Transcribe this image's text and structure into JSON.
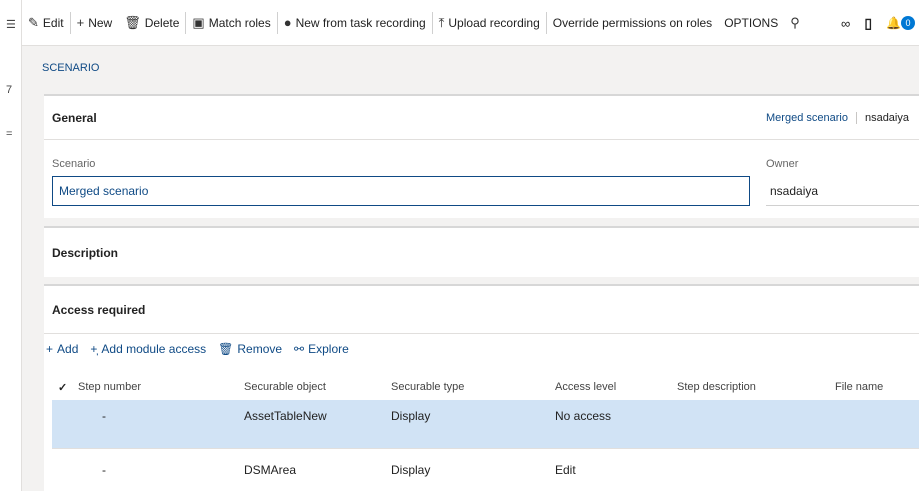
{
  "left_strip": {
    "glyphs": [
      "☰",
      "7",
      "="
    ]
  },
  "toolbar": {
    "edit": "Edit",
    "new": "New",
    "delete": "Delete",
    "match_roles": "Match roles",
    "new_from_task_recording": "New from task recording",
    "upload_recording": "Upload recording",
    "override_permissions": "Override permissions on roles",
    "options": "OPTIONS",
    "notification_count": "0"
  },
  "page": {
    "title": "SCENARIO"
  },
  "general": {
    "header": "General",
    "summary_name": "Merged scenario",
    "summary_owner": "nsadaiya",
    "scenario_label": "Scenario",
    "scenario_value": "Merged scenario",
    "owner_label": "Owner",
    "owner_value": "nsadaiya"
  },
  "description": {
    "header": "Description"
  },
  "access": {
    "header": "Access required",
    "actions": {
      "add": "Add",
      "add_module": "Add module access",
      "remove": "Remove",
      "explore": "Explore"
    },
    "columns": {
      "check": "✓",
      "step_number": "Step number",
      "securable_object": "Securable object",
      "securable_type": "Securable type",
      "access_level": "Access level",
      "step_description": "Step description",
      "file_name": "File name"
    },
    "rows": [
      {
        "step": "-",
        "object": "AssetTableNew",
        "type": "Display",
        "level": "No access",
        "desc": "",
        "file": ""
      },
      {
        "step": "-",
        "object": "DSMArea",
        "type": "Display",
        "level": "Edit",
        "desc": "",
        "file": ""
      }
    ]
  },
  "colors": {
    "accent": "#0f4a85",
    "selected_row": "#d1e3f5",
    "badge": "#0078d4"
  }
}
